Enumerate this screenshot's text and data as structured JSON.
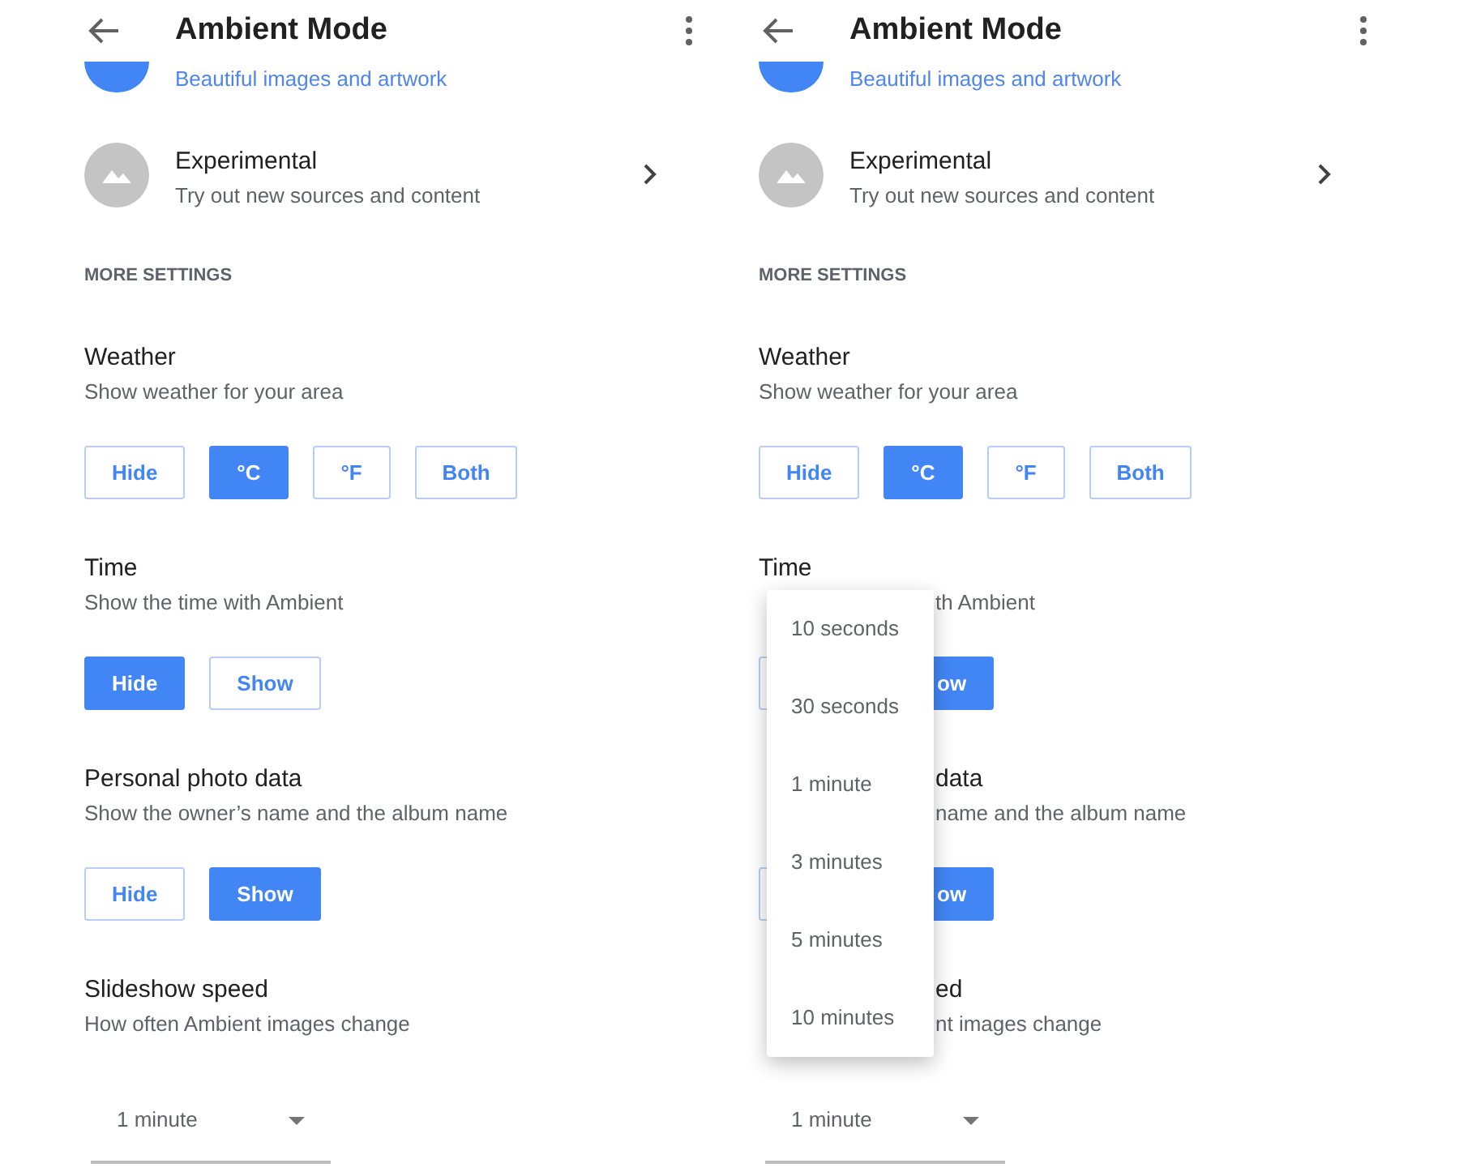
{
  "screens": [
    {
      "header": {
        "title": "Ambient Mode"
      },
      "partial_item": {
        "subtitle": "Beautiful images and artwork"
      },
      "item": {
        "title": "Experimental",
        "subtitle": "Try out new sources and content"
      },
      "section": "MORE SETTINGS",
      "settings": [
        {
          "kind": "choice",
          "title": "Weather",
          "subtitle": "Show weather for your area",
          "options": [
            {
              "label": "Hide",
              "selected": false
            },
            {
              "label": "°C",
              "selected": true
            },
            {
              "label": "°F",
              "selected": false
            },
            {
              "label": "Both",
              "selected": false
            }
          ]
        },
        {
          "kind": "choice",
          "title": "Time",
          "subtitle": "Show the time with Ambient",
          "options": [
            {
              "label": "Hide",
              "selected": true
            },
            {
              "label": "Show",
              "selected": false
            }
          ]
        },
        {
          "kind": "choice",
          "title": "Personal photo data",
          "subtitle": "Show the owner’s name and the album name",
          "options": [
            {
              "label": "Hide",
              "selected": false
            },
            {
              "label": "Show",
              "selected": true
            }
          ]
        },
        {
          "kind": "dropdown",
          "title": "Slideshow speed",
          "subtitle": "How often Ambient images change",
          "value": "1 minute"
        }
      ]
    },
    {
      "header": {
        "title": "Ambient Mode"
      },
      "partial_item": {
        "subtitle": "Beautiful images and artwork"
      },
      "item": {
        "title": "Experimental",
        "subtitle": "Try out new sources and content"
      },
      "section": "MORE SETTINGS",
      "settings": [
        {
          "kind": "choice",
          "title": "Weather",
          "subtitle": "Show weather for your area",
          "options": [
            {
              "label": "Hide",
              "selected": false
            },
            {
              "label": "°C",
              "selected": true
            },
            {
              "label": "°F",
              "selected": false
            },
            {
              "label": "Both",
              "selected": false
            }
          ]
        },
        {
          "kind": "choice",
          "title": "Time",
          "subtitle_tail": "th Ambient",
          "options": [
            {
              "selected": false
            },
            {
              "label_tail": "ow",
              "selected": true
            }
          ]
        },
        {
          "kind": "choice",
          "title_tail": "data",
          "subtitle_tail": "name and the album name",
          "options": [
            {
              "selected": false
            },
            {
              "label_tail": "ow",
              "selected": true
            }
          ]
        },
        {
          "kind": "dropdown",
          "title_tail": "ed",
          "subtitle_tail": "nt images change",
          "value": "1 minute"
        }
      ],
      "menu": {
        "items": [
          "10 seconds",
          "30 seconds",
          "1 minute",
          "3 minutes",
          "5 minutes",
          "10 minutes"
        ]
      }
    }
  ]
}
